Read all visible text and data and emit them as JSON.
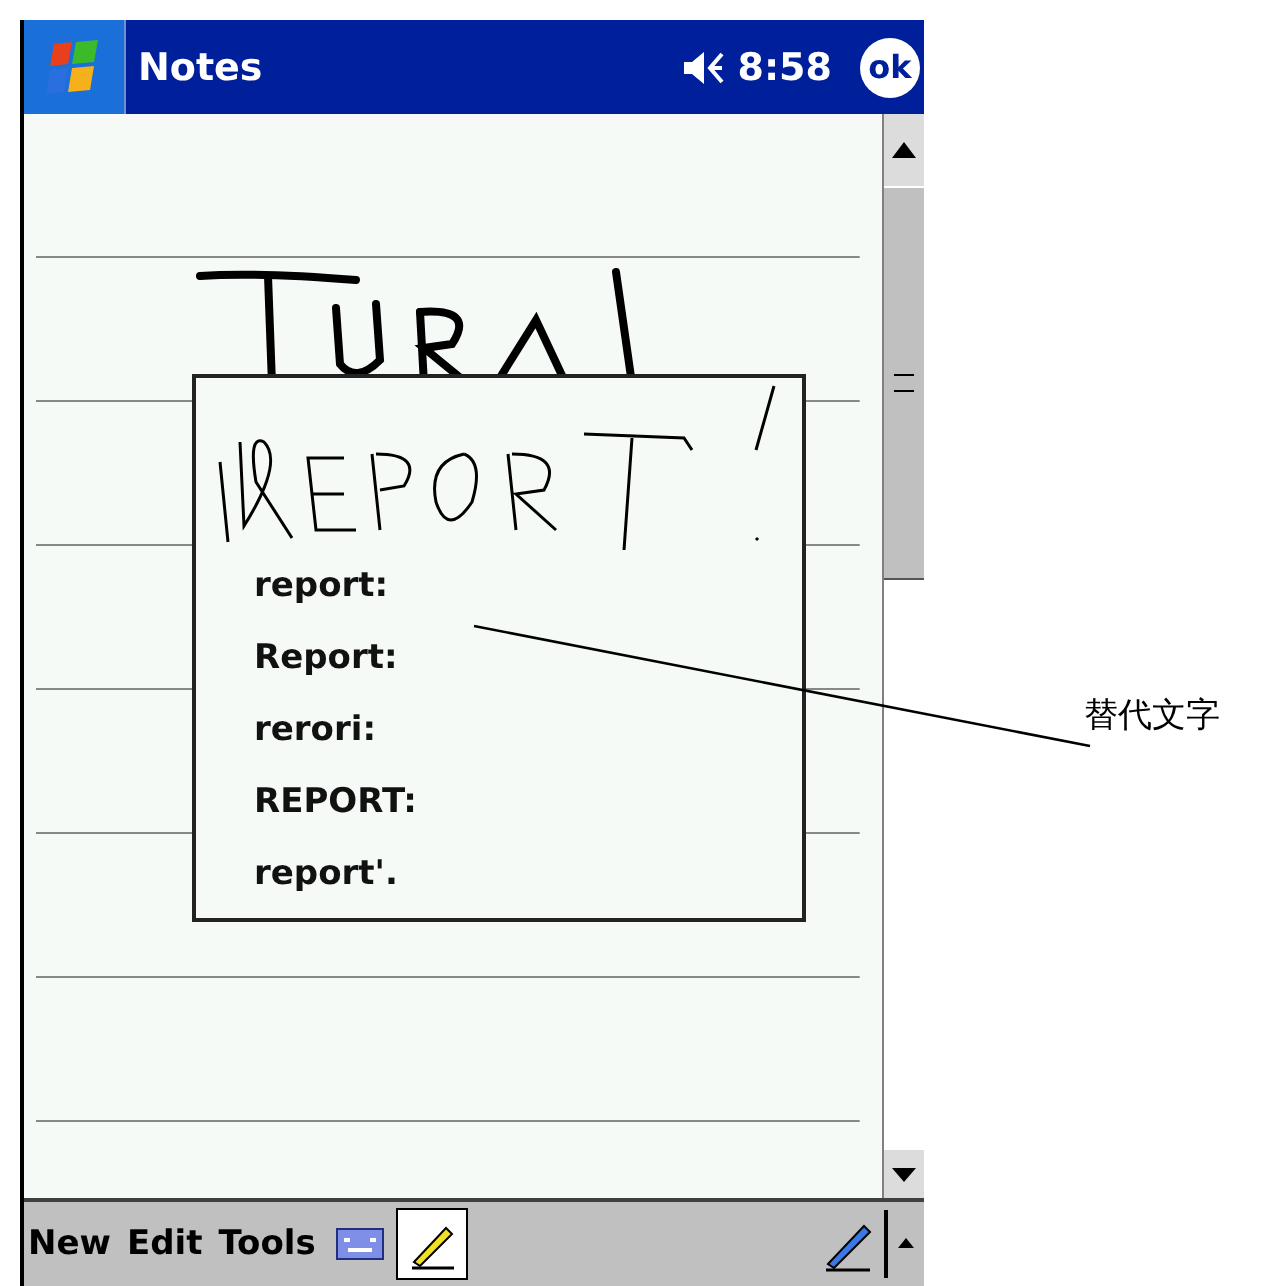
{
  "title_bar": {
    "title": "Notes",
    "time": "8:58",
    "ok": "ok"
  },
  "alternatives_popup": {
    "items": [
      {
        "text": "report:"
      },
      {
        "text": "Report:"
      },
      {
        "text": "rerori:"
      },
      {
        "text": "REPORT:"
      },
      {
        "text": "report'."
      }
    ]
  },
  "toolbar": {
    "menus": [
      "New",
      "Edit",
      "Tools"
    ],
    "pen_mode": {
      "selected": true
    }
  },
  "annotation": {
    "label": "替代文字"
  }
}
